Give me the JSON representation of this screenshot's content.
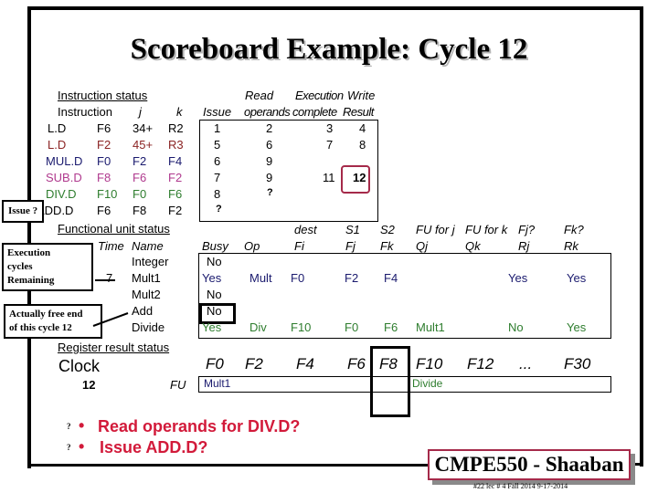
{
  "title": "Scoreboard Example:  Cycle 12",
  "instruction_status": {
    "heading": "Instruction status",
    "col_headers": {
      "instruction": "Instruction",
      "j": "j",
      "k": "k"
    },
    "timing_headers": {
      "issue": "Issue",
      "read_top": "Read",
      "read_bottom": "operands",
      "exec_top": "Execution",
      "exec_bottom": "complete",
      "write_top": "Write",
      "write_bottom": "Result"
    },
    "rows": [
      {
        "op": "L.D",
        "dest": "F6",
        "j": "34+",
        "k": "R2",
        "issue": "1",
        "read": "2",
        "exec": "3",
        "write": "4",
        "color": "#000000"
      },
      {
        "op": "L.D",
        "dest": "F2",
        "j": "45+",
        "k": "R3",
        "issue": "5",
        "read": "6",
        "exec": "7",
        "write": "8",
        "color": "#8b2323"
      },
      {
        "op": "MUL.D",
        "dest": "F0",
        "j": "F2",
        "k": "F4",
        "issue": "6",
        "read": "9",
        "exec": "",
        "write": "",
        "color": "#1a1a6e"
      },
      {
        "op": "SUB.D",
        "dest": "F8",
        "j": "F6",
        "k": "F2",
        "issue": "7",
        "read": "9",
        "exec": "11",
        "write": "12",
        "color": "#b03a8e"
      },
      {
        "op": "DIV.D",
        "dest": "F10",
        "j": "F0",
        "k": "F6",
        "issue": "8",
        "read": "?",
        "exec": "",
        "write": "",
        "color": "#2e7d2e"
      },
      {
        "op": "ADD.D",
        "dest": "F6",
        "j": "F8",
        "k": "F2",
        "issue": "?",
        "read": "",
        "exec": "",
        "write": "",
        "color": "#000000"
      }
    ]
  },
  "functional_unit_status": {
    "heading": "Functional unit status",
    "headers_top": {
      "dest": "dest",
      "s1": "S1",
      "s2": "S2",
      "fuj": "FU for j",
      "fuk": "FU for k",
      "fjq": "Fj?",
      "fkq": "Fk?"
    },
    "headers_bottom": {
      "time": "Time",
      "name": "Name",
      "busy": "Busy",
      "op": "Op",
      "fi": "Fi",
      "fj": "Fj",
      "fk": "Fk",
      "qj": "Qj",
      "qk": "Qk",
      "rj": "Rj",
      "rk": "Rk"
    },
    "rows": [
      {
        "time": "",
        "name": "Integer",
        "busy": "No",
        "op": "",
        "fi": "",
        "fj": "",
        "fk": "",
        "qj": "",
        "qk": "",
        "rj": "",
        "rk": "",
        "color": "#000000"
      },
      {
        "time": "7",
        "name": "Mult1",
        "busy": "Yes",
        "op": "Mult",
        "fi": "F0",
        "fj": "F2",
        "fk": "F4",
        "qj": "",
        "qk": "",
        "rj": "Yes",
        "rk": "Yes",
        "color": "#1a1a6e"
      },
      {
        "time": "",
        "name": "Mult2",
        "busy": "No",
        "op": "",
        "fi": "",
        "fj": "",
        "fk": "",
        "qj": "",
        "qk": "",
        "rj": "",
        "rk": "",
        "color": "#000000"
      },
      {
        "time": "",
        "name": "Add",
        "busy": "No",
        "op": "",
        "fi": "",
        "fj": "",
        "fk": "",
        "qj": "",
        "qk": "",
        "rj": "",
        "rk": "",
        "color": "#000000"
      },
      {
        "time": "",
        "name": "Divide",
        "busy": "Yes",
        "op": "Div",
        "fi": "F10",
        "fj": "F0",
        "fk": "F6",
        "qj": "Mult1",
        "qk": "",
        "rj": "No",
        "rk": "Yes",
        "color": "#2e7d2e"
      }
    ]
  },
  "register_result_status": {
    "heading": "Register result status",
    "clock_label": "Clock",
    "clock_value": "12",
    "fu_label": "FU",
    "registers": [
      "F0",
      "F2",
      "F4",
      "F6",
      "F8",
      "F10",
      "F12",
      "...",
      "F30"
    ],
    "values": [
      "Mult1",
      "",
      "",
      "",
      "",
      "Divide",
      "",
      "",
      ""
    ],
    "value_colors": [
      "#1a1a6e",
      "",
      "",
      "",
      "",
      "#2e7d2e",
      "",
      "",
      ""
    ]
  },
  "callouts": {
    "issue": "Issue ?",
    "execution": [
      "Execution",
      "cycles",
      "Remaining"
    ],
    "free": [
      "Actually free end",
      "of this cycle 12"
    ]
  },
  "questions": [
    {
      "prefix": "?",
      "bullet": "•",
      "text": "Read operands for DIV.D?"
    },
    {
      "prefix": "?",
      "bullet": "•",
      "text": "Issue ADD.D?"
    }
  ],
  "badge": "CMPE550 - Shaaban",
  "footer": "#22  lec # 4 Fall 2014   9-17-2014",
  "colors": {
    "highlight": "#a52a4a",
    "question": "#d21a3a"
  }
}
